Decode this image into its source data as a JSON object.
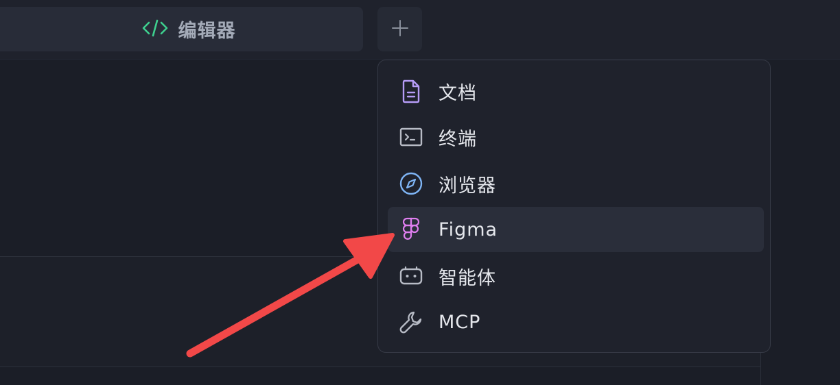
{
  "tabs": {
    "editor_label": "编辑器",
    "add_symbol": "+"
  },
  "menu": {
    "items": [
      {
        "label": "文档",
        "icon": "document-icon",
        "color": "#b69cf7"
      },
      {
        "label": "终端",
        "icon": "terminal-icon",
        "color": "#b8bcc6"
      },
      {
        "label": "浏览器",
        "icon": "compass-icon",
        "color": "#7fb5f5"
      },
      {
        "label": "Figma",
        "icon": "figma-icon",
        "color": "#e07ff0",
        "highlighted": true
      },
      {
        "label": "智能体",
        "icon": "robot-icon",
        "color": "#b8bcc6"
      },
      {
        "label": "MCP",
        "icon": "wrench-icon",
        "color": "#b8bcc6"
      }
    ]
  },
  "colors": {
    "background": "#1b1e27",
    "accent_green": "#3ecf8e",
    "annotation_arrow": "#f24848"
  }
}
